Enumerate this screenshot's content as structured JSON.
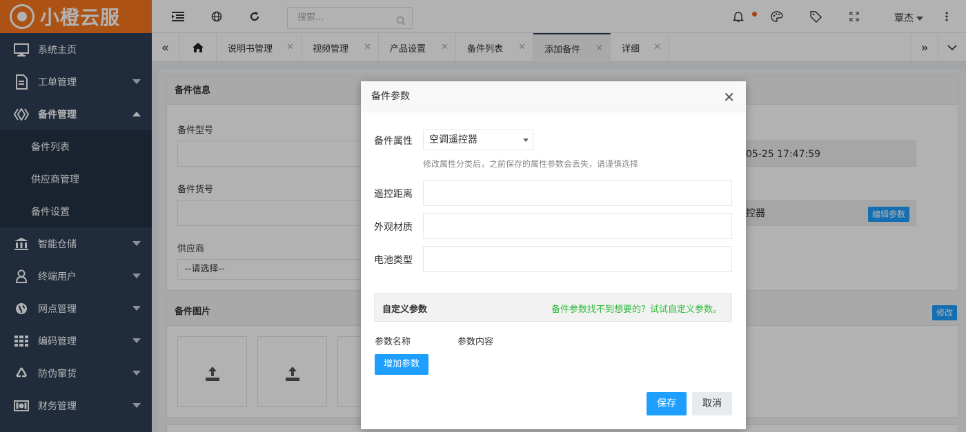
{
  "brand": {
    "name": "小橙云服"
  },
  "sidebar": {
    "items": [
      {
        "label": "系统主页",
        "icon": "monitor-icon"
      },
      {
        "label": "工单管理",
        "icon": "document-icon"
      },
      {
        "label": "备件管理",
        "icon": "diamond-icon"
      },
      {
        "label": "智能仓储",
        "icon": "bank-icon"
      },
      {
        "label": "终端用户",
        "icon": "user-icon"
      },
      {
        "label": "网点管理",
        "icon": "globe-icon"
      },
      {
        "label": "编码管理",
        "icon": "grid-icon"
      },
      {
        "label": "防伪窜货",
        "icon": "recycle-icon"
      },
      {
        "label": "财务管理",
        "icon": "money-icon"
      }
    ],
    "sub_items": [
      "备件列表",
      "供应商管理",
      "备件设置"
    ]
  },
  "topbar": {
    "search_placeholder": "搜索...",
    "user_name": "覃杰"
  },
  "tabs": [
    {
      "label": "说明书管理"
    },
    {
      "label": "视频管理"
    },
    {
      "label": "产品设置"
    },
    {
      "label": "备件列表"
    },
    {
      "label": "添加备件"
    },
    {
      "label": "详细"
    }
  ],
  "page": {
    "panel_info_title": "备件信息",
    "field_model": "备件型号",
    "field_sku": "备件货号",
    "field_supplier": "供应商",
    "supplier_value": "--请选择--",
    "panel_images_title": "备件图片",
    "partial_date": "05-25 17:47:59",
    "partial_attr": "控器",
    "edit_params_btn": "编辑参数",
    "modify_btn": "修改"
  },
  "dialog": {
    "title": "备件参数",
    "attr_label": "备件属性",
    "attr_value": "空调遥控器",
    "attr_hint": "修改属性分类后，之前保存的属性参数会丢失，请谨慎选择",
    "field1": "遥控距离",
    "field2": "外观材质",
    "field3": "电池类型",
    "custom_title": "自定义参数",
    "custom_hint": "备件参数找不到想要的？试试自定义参数。",
    "col_name": "参数名称",
    "col_value": "参数内容",
    "add_btn": "增加参数",
    "save_btn": "保存",
    "cancel_btn": "取消"
  },
  "colors": {
    "brand": "#f6761d",
    "sidebar": "#2f4056",
    "primary": "#1e9fff",
    "success_text": "#2eb83d"
  }
}
